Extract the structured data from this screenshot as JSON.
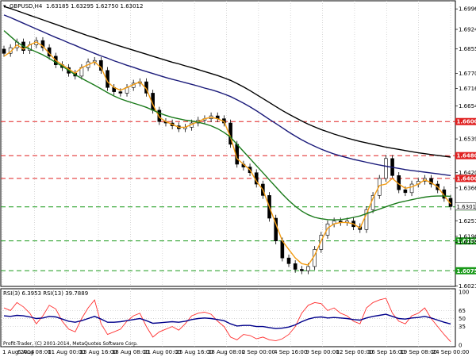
{
  "header": {
    "symbol": "GBPUSD,H4",
    "ohlc": "1.63185 1.63295 1.62750 1.63012"
  },
  "rsi_header": {
    "label": "RSI(3) 6.3953 RSI(13) 39.7889"
  },
  "copyright": "Profit-Trader, (C) 2001-2014, MetaQuotes Software Corp.",
  "colors": {
    "candles": "#000000",
    "ema_short": "#f39c12",
    "ma_green": "#1a7a1a",
    "ma_navy": "#1a1a7a",
    "ma_black": "#000000",
    "resistance": "#e02020",
    "support": "#1a9a1a",
    "rsi_fast": "#ff3030",
    "rsi_slow": "#00008b",
    "label_red_bg": "#e02020",
    "label_green_bg": "#1a9a1a"
  },
  "chart_data": {
    "type": "line",
    "price_ticks": [
      "1.69965",
      "1.69245",
      "1.68555",
      "1.67700",
      "1.67165",
      "1.66545",
      "1.65390",
      "1.64200",
      "1.63665",
      "1.62510",
      "1.61960",
      "1.61750",
      "1.60215"
    ],
    "ylim": [
      1.602,
      1.7025
    ],
    "x_ticks": [
      "1 Aug 2014",
      "6 Aug 08:00",
      "11 Aug 00:00",
      "13 Aug 16:00",
      "18 Aug 08:00",
      "21 Aug 00:00",
      "25 Aug 16:00",
      "28 Aug 08:00",
      "2 Sep 00:00",
      "4 Sep 16:00",
      "9 Sep 00:00",
      "12 Sep 00:00",
      "16 Sep 16:00",
      "19 Sep 08:00",
      "24 Sep 00:00"
    ],
    "levels": [
      {
        "value": "1.66000",
        "kind": "resistance"
      },
      {
        "value": "1.64800",
        "kind": "resistance"
      },
      {
        "value": "1.64000",
        "kind": "resistance"
      },
      {
        "value": "1.63000",
        "kind": "support"
      },
      {
        "value": "1.61800",
        "kind": "support"
      },
      {
        "value": "1.60750",
        "kind": "support"
      }
    ],
    "current_price": "1.63012",
    "series": [
      {
        "values": [
          1.683,
          1.6845,
          1.687,
          1.6855,
          1.687,
          1.688,
          1.6865,
          1.684,
          1.6815,
          1.68,
          1.6785,
          1.677,
          1.679,
          1.68,
          1.681,
          1.679,
          1.674,
          1.672,
          1.671,
          1.672,
          1.673,
          1.674,
          1.6715,
          1.666,
          1.6615,
          1.66,
          1.659,
          1.658,
          1.658,
          1.659,
          1.66,
          1.661,
          1.6615,
          1.661,
          1.66,
          1.6545,
          1.647,
          1.645,
          1.643,
          1.639,
          1.636,
          1.63,
          1.624,
          1.618,
          1.615,
          1.612,
          1.61,
          1.6095,
          1.613,
          1.618,
          1.6225,
          1.624,
          1.6245,
          1.6245,
          1.624,
          1.6225,
          1.6275,
          1.633,
          1.6375,
          1.638,
          1.64,
          1.638,
          1.6365,
          1.637,
          1.638,
          1.6395,
          1.6385,
          1.637,
          1.634,
          1.631
        ]
      },
      {
        "values": [
          1.692,
          1.69,
          1.688,
          1.6865,
          1.6855,
          1.6845,
          1.6835,
          1.6822,
          1.6808,
          1.6795,
          1.678,
          1.6765,
          1.6752,
          1.674,
          1.6728,
          1.6715,
          1.6702,
          1.669,
          1.668,
          1.6672,
          1.6665,
          1.6658,
          1.665,
          1.664,
          1.663,
          1.6622,
          1.6615,
          1.661,
          1.6605,
          1.6602,
          1.6598,
          1.6592,
          1.6585,
          1.6575,
          1.6562,
          1.6545,
          1.652,
          1.6495,
          1.647,
          1.6445,
          1.642,
          1.6395,
          1.637,
          1.6345,
          1.6322,
          1.6302,
          1.6285,
          1.6272,
          1.6263,
          1.6258,
          1.6255,
          1.6254,
          1.6255,
          1.6258,
          1.6263,
          1.6268,
          1.6276,
          1.6284,
          1.6292,
          1.63,
          1.6308,
          1.6315,
          1.632,
          1.6325,
          1.633,
          1.6334,
          1.6337,
          1.6338,
          1.6338,
          1.6337
        ]
      },
      {
        "values": [
          1.6975,
          1.6966,
          1.6956,
          1.6946,
          1.6936,
          1.6926,
          1.6916,
          1.6906,
          1.6896,
          1.6887,
          1.6877,
          1.6868,
          1.6858,
          1.6849,
          1.684,
          1.6831,
          1.6823,
          1.6814,
          1.6806,
          1.6798,
          1.6791,
          1.6783,
          1.6776,
          1.6769,
          1.6762,
          1.6755,
          1.6749,
          1.6743,
          1.6737,
          1.6731,
          1.6725,
          1.6718,
          1.6712,
          1.6705,
          1.6697,
          1.6688,
          1.6677,
          1.6665,
          1.6652,
          1.6638,
          1.6623,
          1.6608,
          1.6593,
          1.6578,
          1.6563,
          1.6549,
          1.6536,
          1.6524,
          1.6513,
          1.6503,
          1.6494,
          1.6486,
          1.6479,
          1.6473,
          1.6467,
          1.6462,
          1.6457,
          1.6452,
          1.6447,
          1.6443,
          1.6439,
          1.6435,
          1.6431,
          1.6428,
          1.6425,
          1.6422,
          1.6419,
          1.6416,
          1.6413,
          1.641
        ]
      },
      {
        "values": [
          1.7005,
          1.6998,
          1.699,
          1.6982,
          1.6974,
          1.6966,
          1.6958,
          1.695,
          1.6942,
          1.6934,
          1.6926,
          1.6918,
          1.691,
          1.6902,
          1.6895,
          1.6887,
          1.688,
          1.6872,
          1.6865,
          1.6858,
          1.6851,
          1.6844,
          1.6837,
          1.683,
          1.6823,
          1.6816,
          1.6809,
          1.6803,
          1.6796,
          1.679,
          1.6783,
          1.6776,
          1.6769,
          1.6762,
          1.6754,
          1.6745,
          1.6734,
          1.6722,
          1.6709,
          1.6695,
          1.6681,
          1.6667,
          1.6653,
          1.6639,
          1.6626,
          1.6614,
          1.6602,
          1.6591,
          1.6581,
          1.6572,
          1.6564,
          1.6556,
          1.6549,
          1.6542,
          1.6536,
          1.653,
          1.6525,
          1.652,
          1.6515,
          1.651,
          1.6506,
          1.6502,
          1.6498,
          1.6494,
          1.649,
          1.6487,
          1.6484,
          1.6481,
          1.6478,
          1.6475
        ]
      }
    ],
    "candles": [
      1.684,
      1.686,
      1.688,
      1.685,
      1.687,
      1.6885,
      1.686,
      1.683,
      1.68,
      1.679,
      1.677,
      1.676,
      1.679,
      1.681,
      1.6815,
      1.678,
      1.672,
      1.6705,
      1.67,
      1.672,
      1.6735,
      1.674,
      1.67,
      1.664,
      1.66,
      1.6595,
      1.6585,
      1.6575,
      1.658,
      1.6595,
      1.6605,
      1.661,
      1.662,
      1.661,
      1.6595,
      1.652,
      1.645,
      1.644,
      1.642,
      1.638,
      1.634,
      1.626,
      1.618,
      1.612,
      1.61,
      1.608,
      1.6075,
      1.609,
      1.615,
      1.62,
      1.624,
      1.625,
      1.6245,
      1.625,
      1.623,
      1.622,
      1.629,
      1.634,
      1.64,
      1.647,
      1.641,
      1.636,
      1.635,
      1.638,
      1.639,
      1.64,
      1.638,
      1.636,
      1.633,
      1.6301
    ],
    "rsi": {
      "ticks": [
        "100",
        "65",
        "50",
        "35",
        "0"
      ],
      "fast": [
        70,
        65,
        80,
        72,
        60,
        40,
        55,
        75,
        68,
        45,
        30,
        25,
        50,
        70,
        85,
        40,
        20,
        25,
        30,
        45,
        55,
        60,
        35,
        15,
        25,
        30,
        35,
        28,
        40,
        55,
        60,
        62,
        58,
        45,
        35,
        15,
        10,
        20,
        18,
        12,
        15,
        10,
        8,
        12,
        20,
        35,
        60,
        75,
        80,
        78,
        65,
        70,
        60,
        55,
        45,
        40,
        70,
        80,
        85,
        88,
        60,
        45,
        40,
        55,
        60,
        70,
        50,
        35,
        20,
        6.4
      ],
      "slow": [
        55,
        54,
        56,
        55,
        53,
        50,
        51,
        54,
        53,
        49,
        45,
        43,
        46,
        50,
        54,
        49,
        43,
        43,
        44,
        46,
        48,
        50,
        46,
        41,
        42,
        43,
        44,
        43,
        45,
        48,
        50,
        51,
        50,
        48,
        46,
        40,
        36,
        37,
        37,
        35,
        35,
        33,
        31,
        32,
        34,
        38,
        44,
        49,
        52,
        53,
        51,
        52,
        51,
        50,
        48,
        47,
        51,
        54,
        56,
        58,
        54,
        50,
        49,
        51,
        52,
        54,
        51,
        47,
        43,
        39.8
      ]
    }
  }
}
